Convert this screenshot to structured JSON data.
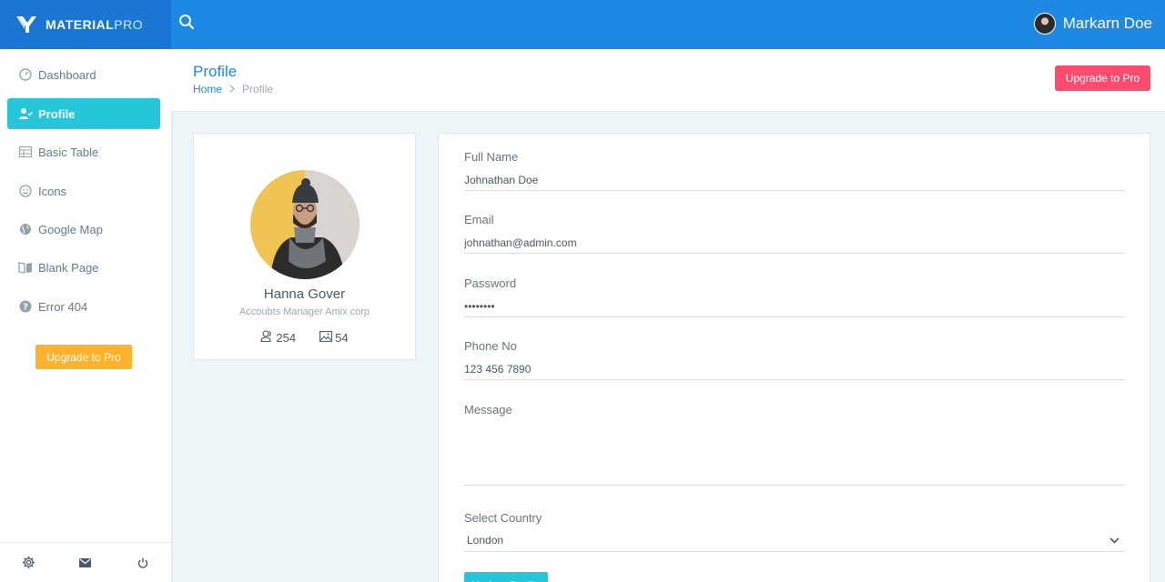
{
  "brand": {
    "name_bold": "MATERIAL",
    "name_light": "PRO"
  },
  "topbar": {
    "user_name": "Markarn Doe",
    "search_icon": "search-icon"
  },
  "sidebar": {
    "items": [
      {
        "label": "Dashboard",
        "icon": "dashboard-icon",
        "active": false
      },
      {
        "label": "Profile",
        "icon": "account-check-icon",
        "active": true
      },
      {
        "label": "Basic Table",
        "icon": "table-icon",
        "active": false
      },
      {
        "label": "Icons",
        "icon": "smiley-icon",
        "active": false
      },
      {
        "label": "Google Map",
        "icon": "globe-icon",
        "active": false
      },
      {
        "label": "Blank Page",
        "icon": "book-open-icon",
        "active": false
      },
      {
        "label": "Error 404",
        "icon": "help-circle-icon",
        "active": false
      }
    ],
    "upgrade_label": "Upgrade to Pro",
    "footer_icons": [
      "settings-icon",
      "mail-icon",
      "power-icon"
    ]
  },
  "header": {
    "title": "Profile",
    "breadcrumb": {
      "home": "Home",
      "separator": ">",
      "current": "Profile"
    },
    "upgrade_label": "Upgrade to Pro"
  },
  "profile": {
    "name": "Hanna Gover",
    "role": "Accoubts Manager Amix corp",
    "followers": "254",
    "photos": "54"
  },
  "form": {
    "full_name_label": "Full Name",
    "full_name_value": "Johnathan Doe",
    "email_label": "Email",
    "email_value": "johnathan@admin.com",
    "password_label": "Password",
    "password_value": "password",
    "phone_label": "Phone No",
    "phone_value": "123 456 7890",
    "message_label": "Message",
    "message_value": "",
    "country_label": "Select Country",
    "country_value": "London",
    "submit_label": "Update Profile"
  },
  "colors": {
    "topbar": "#1e88e5",
    "brand_bg": "#1976d2",
    "active_nav": "#26c6da",
    "sidebar_upgrade": "#ffb22b",
    "header_upgrade": "#fc4b6c",
    "title_blue": "#1e88e5"
  }
}
